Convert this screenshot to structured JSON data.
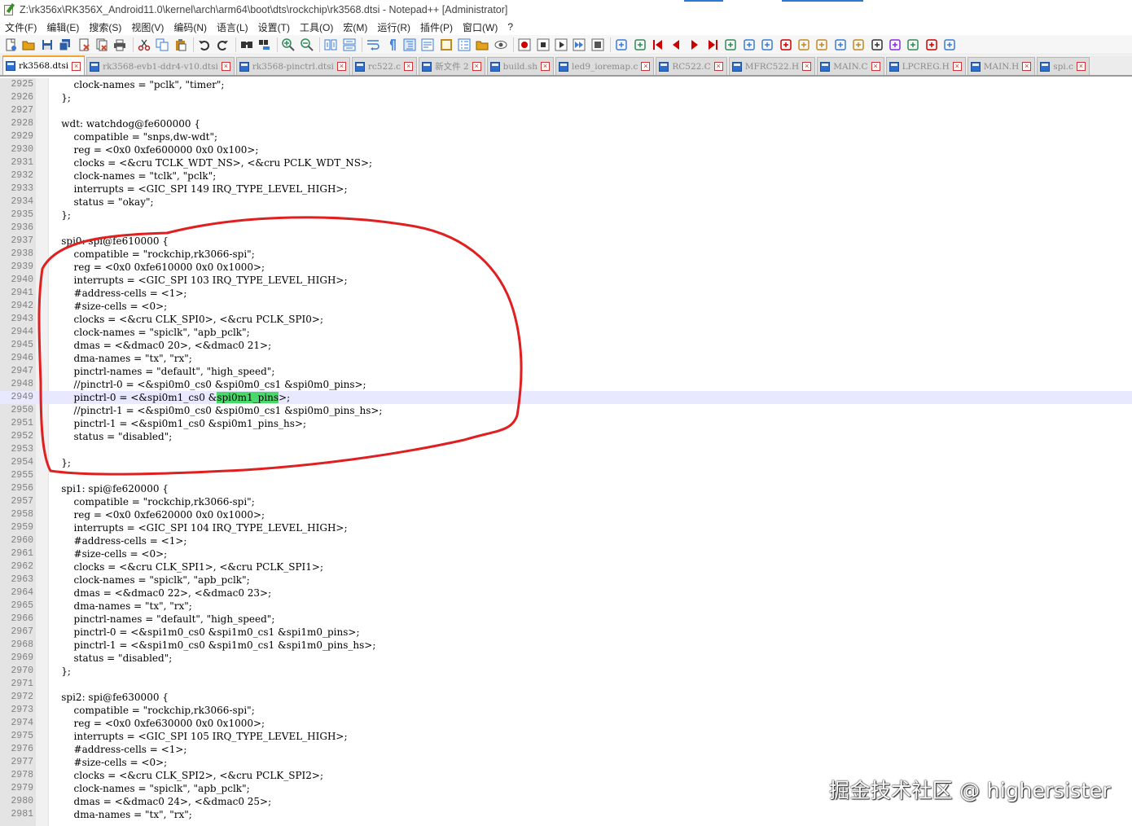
{
  "window": {
    "title": "Z:\\rk356x\\RK356X_Android11.0\\kernel\\arch\\arm64\\boot\\dts\\rockchip\\rk3568.dtsi - Notepad++ [Administrator]"
  },
  "menu": [
    "文件(F)",
    "编辑(E)",
    "搜索(S)",
    "视图(V)",
    "编码(N)",
    "语言(L)",
    "设置(T)",
    "工具(O)",
    "宏(M)",
    "运行(R)",
    "插件(P)",
    "窗口(W)",
    "?"
  ],
  "toolbar": {
    "icons": [
      {
        "name": "new-file-icon",
        "color": "#3a7bd5"
      },
      {
        "name": "open-file-icon",
        "color": "#e3a21a"
      },
      {
        "name": "save-icon",
        "color": "#2d5fa8"
      },
      {
        "name": "save-all-icon",
        "color": "#2d5fa8"
      },
      {
        "name": "close-icon",
        "color": "#d04a2a"
      },
      {
        "name": "close-all-icon",
        "color": "#d04a2a"
      },
      {
        "name": "print-icon",
        "color": "#555555"
      },
      {
        "sep": true
      },
      {
        "name": "cut-icon",
        "color": "#b22222"
      },
      {
        "name": "copy-icon",
        "color": "#3a7bd5"
      },
      {
        "name": "paste-icon",
        "color": "#c08a20"
      },
      {
        "sep": true
      },
      {
        "name": "undo-icon",
        "color": "#333333"
      },
      {
        "name": "redo-icon",
        "color": "#333333"
      },
      {
        "sep": true
      },
      {
        "name": "find-icon",
        "color": "#333333"
      },
      {
        "name": "replace-icon",
        "color": "#3a7bd5"
      },
      {
        "sep": true
      },
      {
        "name": "zoom-in-icon",
        "color": "#2e8b57"
      },
      {
        "name": "zoom-out-icon",
        "color": "#2e8b57"
      },
      {
        "sep": true
      },
      {
        "name": "sync-vertical-icon",
        "color": "#3a7bd5"
      },
      {
        "name": "sync-horizontal-icon",
        "color": "#3a7bd5"
      },
      {
        "sep": true
      },
      {
        "name": "word-wrap-icon",
        "color": "#3a7bd5"
      },
      {
        "name": "show-all-chars-icon",
        "color": "#3a7bd5"
      },
      {
        "name": "indent-guide-icon",
        "color": "#3a7bd5"
      },
      {
        "name": "user-language-icon",
        "color": "#3a7bd5"
      },
      {
        "name": "doc-map-icon",
        "color": "#c08a20"
      },
      {
        "name": "function-list-icon",
        "color": "#3a7bd5"
      },
      {
        "name": "folder-workspace-icon",
        "color": "#e3a21a"
      },
      {
        "name": "monitoring-icon",
        "color": "#555555"
      },
      {
        "sep": true
      },
      {
        "name": "record-macro-icon",
        "color": "#cc0000"
      },
      {
        "name": "stop-record-icon",
        "color": "#333333"
      },
      {
        "name": "playback-icon",
        "color": "#333333"
      },
      {
        "name": "run-macro-multiple-icon",
        "color": "#3a7bd5"
      },
      {
        "name": "save-macro-icon",
        "color": "#555555"
      },
      {
        "sep": true
      },
      {
        "name": "plugin-a-icon",
        "color": "#3a7bd5"
      },
      {
        "name": "plugin-b-icon",
        "color": "#2e8b57"
      },
      {
        "name": "first-icon",
        "color": "#cc0000"
      },
      {
        "name": "prev-icon",
        "color": "#cc0000"
      },
      {
        "name": "next-icon",
        "color": "#cc0000"
      },
      {
        "name": "last-icon",
        "color": "#cc0000"
      },
      {
        "name": "plugin-c-icon",
        "color": "#2e8b57"
      },
      {
        "name": "plugin-d-icon",
        "color": "#3a7bd5"
      },
      {
        "name": "plugin-e-icon",
        "color": "#3a7bd5"
      },
      {
        "name": "plugin-f-icon",
        "color": "#cc0000"
      },
      {
        "name": "plugin-g-icon",
        "color": "#c08a20"
      },
      {
        "name": "plugin-h-icon",
        "color": "#c08a20"
      },
      {
        "name": "plugin-i-icon",
        "color": "#3a7bd5"
      },
      {
        "name": "plugin-j-icon",
        "color": "#c08a20"
      },
      {
        "name": "plugin-k-icon",
        "color": "#333333"
      },
      {
        "name": "plugin-l-icon",
        "color": "#8a2be2"
      },
      {
        "name": "plugin-m-icon",
        "color": "#2e8b57"
      },
      {
        "name": "plugin-n-icon",
        "color": "#cc0000"
      },
      {
        "name": "plugin-o-icon",
        "color": "#3a7bd5"
      }
    ]
  },
  "tabs": [
    {
      "label": "rk3568.dtsi",
      "active": true
    },
    {
      "label": "rk3568-evb1-ddr4-v10.dtsi",
      "active": false
    },
    {
      "label": "rk3568-pinctrl.dtsi",
      "active": false
    },
    {
      "label": "rc522.c",
      "active": false
    },
    {
      "label": "新文件 2",
      "active": false
    },
    {
      "label": "build.sh",
      "active": false
    },
    {
      "label": "led9_ioremap.c",
      "active": false
    },
    {
      "label": "RC522.C",
      "active": false
    },
    {
      "label": "MFRC522.H",
      "active": false
    },
    {
      "label": "MAIN.C",
      "active": false
    },
    {
      "label": "LPCREG.H",
      "active": false
    },
    {
      "label": "MAIN.H",
      "active": false
    },
    {
      "label": "spi.c",
      "active": false
    }
  ],
  "editor": {
    "current_line": 2949,
    "highlight_word": "spi0m1_pins",
    "lines": [
      {
        "n": "2925",
        "text": "\t\tclock-names = \"pclk\", \"timer\";"
      },
      {
        "n": "2926",
        "text": "\t};"
      },
      {
        "n": "2927",
        "text": ""
      },
      {
        "n": "2928",
        "text": "\twdt: watchdog@fe600000 {"
      },
      {
        "n": "2929",
        "text": "\t\tcompatible = \"snps,dw-wdt\";"
      },
      {
        "n": "2930",
        "text": "\t\treg = <0x0 0xfe600000 0x0 0x100>;"
      },
      {
        "n": "2931",
        "text": "\t\tclocks = <&cru TCLK_WDT_NS>, <&cru PCLK_WDT_NS>;"
      },
      {
        "n": "2932",
        "text": "\t\tclock-names = \"tclk\", \"pclk\";"
      },
      {
        "n": "2933",
        "text": "\t\tinterrupts = <GIC_SPI 149 IRQ_TYPE_LEVEL_HIGH>;"
      },
      {
        "n": "2934",
        "text": "\t\tstatus = \"okay\";"
      },
      {
        "n": "2935",
        "text": "\t};"
      },
      {
        "n": "2936",
        "text": ""
      },
      {
        "n": "2937",
        "text": "\tspi0: spi@fe610000 {"
      },
      {
        "n": "2938",
        "text": "\t\tcompatible = \"rockchip,rk3066-spi\";"
      },
      {
        "n": "2939",
        "text": "\t\treg = <0x0 0xfe610000 0x0 0x1000>;"
      },
      {
        "n": "2940",
        "text": "\t\tinterrupts = <GIC_SPI 103 IRQ_TYPE_LEVEL_HIGH>;"
      },
      {
        "n": "2941",
        "text": "\t\t#address-cells = <1>;"
      },
      {
        "n": "2942",
        "text": "\t\t#size-cells = <0>;"
      },
      {
        "n": "2943",
        "text": "\t\tclocks = <&cru CLK_SPI0>, <&cru PCLK_SPI0>;"
      },
      {
        "n": "2944",
        "text": "\t\tclock-names = \"spiclk\", \"apb_pclk\";"
      },
      {
        "n": "2945",
        "text": "\t\tdmas = <&dmac0 20>, <&dmac0 21>;"
      },
      {
        "n": "2946",
        "text": "\t\tdma-names = \"tx\", \"rx\";"
      },
      {
        "n": "2947",
        "text": "\t\tpinctrl-names = \"default\", \"high_speed\";"
      },
      {
        "n": "2948",
        "text": "\t\t//pinctrl-0 = <&spi0m0_cs0 &spi0m0_cs1 &spi0m0_pins>;"
      },
      {
        "n": "2949",
        "text": "\t\tpinctrl-0 = <&spi0m1_cs0 &spi0m1_pins>;"
      },
      {
        "n": "2950",
        "text": "\t\t//pinctrl-1 = <&spi0m0_cs0 &spi0m0_cs1 &spi0m0_pins_hs>;"
      },
      {
        "n": "2951",
        "text": "\t\tpinctrl-1 = <&spi0m1_cs0 &spi0m1_pins_hs>;"
      },
      {
        "n": "2952",
        "text": "\t\tstatus = \"disabled\";"
      },
      {
        "n": "2953",
        "text": ""
      },
      {
        "n": "2954",
        "text": "\t};"
      },
      {
        "n": "2955",
        "text": ""
      },
      {
        "n": "2956",
        "text": "\tspi1: spi@fe620000 {"
      },
      {
        "n": "2957",
        "text": "\t\tcompatible = \"rockchip,rk3066-spi\";"
      },
      {
        "n": "2958",
        "text": "\t\treg = <0x0 0xfe620000 0x0 0x1000>;"
      },
      {
        "n": "2959",
        "text": "\t\tinterrupts = <GIC_SPI 104 IRQ_TYPE_LEVEL_HIGH>;"
      },
      {
        "n": "2960",
        "text": "\t\t#address-cells = <1>;"
      },
      {
        "n": "2961",
        "text": "\t\t#size-cells = <0>;"
      },
      {
        "n": "2962",
        "text": "\t\tclocks = <&cru CLK_SPI1>, <&cru PCLK_SPI1>;"
      },
      {
        "n": "2963",
        "text": "\t\tclock-names = \"spiclk\", \"apb_pclk\";"
      },
      {
        "n": "2964",
        "text": "\t\tdmas = <&dmac0 22>, <&dmac0 23>;"
      },
      {
        "n": "2965",
        "text": "\t\tdma-names = \"tx\", \"rx\";"
      },
      {
        "n": "2966",
        "text": "\t\tpinctrl-names = \"default\", \"high_speed\";"
      },
      {
        "n": "2967",
        "text": "\t\tpinctrl-0 = <&spi1m0_cs0 &spi1m0_cs1 &spi1m0_pins>;"
      },
      {
        "n": "2968",
        "text": "\t\tpinctrl-1 = <&spi1m0_cs0 &spi1m0_cs1 &spi1m0_pins_hs>;"
      },
      {
        "n": "2969",
        "text": "\t\tstatus = \"disabled\";"
      },
      {
        "n": "2970",
        "text": "\t};"
      },
      {
        "n": "2971",
        "text": ""
      },
      {
        "n": "2972",
        "text": "\tspi2: spi@fe630000 {"
      },
      {
        "n": "2973",
        "text": "\t\tcompatible = \"rockchip,rk3066-spi\";"
      },
      {
        "n": "2974",
        "text": "\t\treg = <0x0 0xfe630000 0x0 0x1000>;"
      },
      {
        "n": "2975",
        "text": "\t\tinterrupts = <GIC_SPI 105 IRQ_TYPE_LEVEL_HIGH>;"
      },
      {
        "n": "2976",
        "text": "\t\t#address-cells = <1>;"
      },
      {
        "n": "2977",
        "text": "\t\t#size-cells = <0>;"
      },
      {
        "n": "2978",
        "text": "\t\tclocks = <&cru CLK_SPI2>, <&cru PCLK_SPI2>;"
      },
      {
        "n": "2979",
        "text": "\t\tclock-names = \"spiclk\", \"apb_pclk\";"
      },
      {
        "n": "2980",
        "text": "\t\tdmas = <&dmac0 24>, <&dmac0 25>;"
      },
      {
        "n": "2981",
        "text": "\t\tdma-names = \"tx\", \"rx\";"
      }
    ]
  },
  "watermark": "掘金技术社区 @ highersister",
  "colors": {
    "annotation": "#e02020",
    "current_line_bg": "#e8e8ff",
    "word_highlight": "#4bd86a",
    "active_tab_accent": "#f4a12a"
  }
}
